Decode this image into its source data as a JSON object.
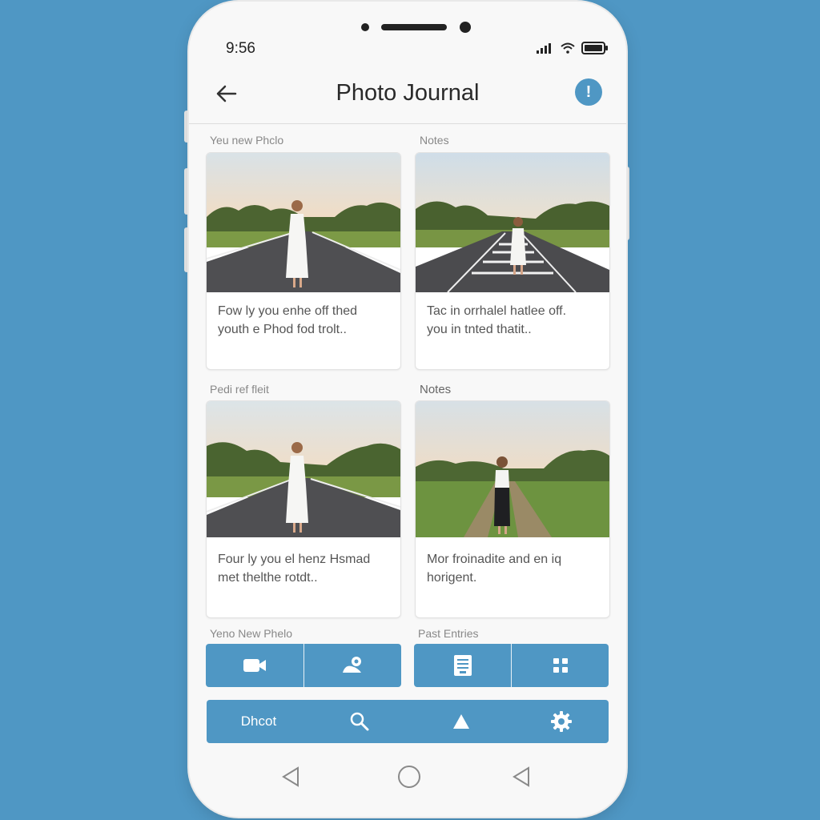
{
  "status": {
    "time": "9:56"
  },
  "header": {
    "title": "Photo Journal",
    "info_label": "!"
  },
  "sections": [
    {
      "label": "Yeu new Phclo"
    },
    {
      "label": "Notes"
    },
    {
      "label": "Pedi ref fleit"
    },
    {
      "label": "Notes"
    }
  ],
  "cards": [
    {
      "text_line1": "Fow ly you enhe off thed",
      "text_line2": "youth e Phod fod trolt.."
    },
    {
      "text_line1": "Tac in orrhalel hatlee off.",
      "text_line2": "you in tnted thatit.."
    },
    {
      "text_line1": "Four ly you el henz Hsmad",
      "text_line2": "met thelthe rotdt.."
    },
    {
      "text_line1": "Mor froinadite and en iq",
      "text_line2": "horigent."
    }
  ],
  "bottom_labels": {
    "left": "Yeno New Phelo",
    "right": "Past Entries"
  },
  "tabbar": {
    "home_label": "Dhcot"
  },
  "icons": [
    "back-arrow-icon",
    "info-icon",
    "video-camera-icon",
    "add-location-icon",
    "document-icon",
    "grid-icon",
    "search-icon",
    "triangle-icon",
    "gear-icon",
    "nav-back-icon",
    "nav-home-icon",
    "nav-recent-icon"
  ],
  "colors": {
    "accent": "#4f97c4",
    "background": "#4f97c4",
    "phone": "#f8f8f8"
  }
}
